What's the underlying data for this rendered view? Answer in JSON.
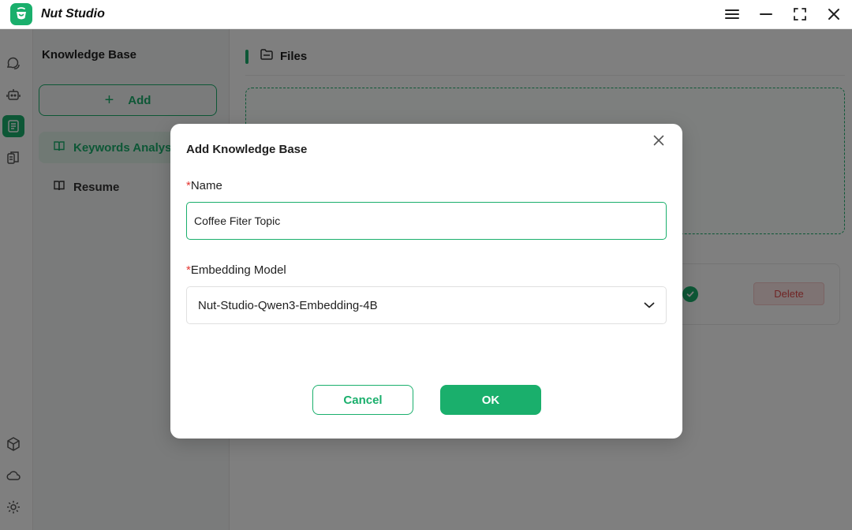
{
  "app": {
    "title": "Nut Studio",
    "logo_icon": "nut-logo-icon",
    "accent_color": "#1aaf6c"
  },
  "window_controls": {
    "icons": [
      "menu-icon",
      "minimize-icon",
      "fullscreen-icon",
      "close-icon"
    ]
  },
  "rail": {
    "top_icons": [
      "chat-icon",
      "robot-icon",
      "knowledge-base-icon",
      "library-icon"
    ],
    "active": "knowledge-base-icon",
    "bottom_icons": [
      "cube-icon",
      "cloud-icon",
      "settings-icon"
    ]
  },
  "knowledge_base": {
    "title": "Knowledge Base",
    "add_label": "Add",
    "items": [
      {
        "label": "Keywords Analysis",
        "icon": "book-icon",
        "selected": true
      },
      {
        "label": "Resume",
        "icon": "book-icon",
        "selected": false
      }
    ]
  },
  "main": {
    "section_title": "Files",
    "section_icon": "folder-icon",
    "file_row": {
      "status_icon": "check-circle-icon",
      "delete_label": "Delete"
    }
  },
  "modal": {
    "title": "Add Knowledge Base",
    "close_icon": "close-icon",
    "name_field": {
      "required_mark": "*",
      "label": "Name",
      "value": "Coffee Fiter Topic"
    },
    "model_field": {
      "required_mark": "*",
      "label": "Embedding Model",
      "selected": "Nut-Studio-Qwen3-Embedding-4B",
      "icon": "chevron-down-icon"
    },
    "cancel_label": "Cancel",
    "ok_label": "OK"
  }
}
